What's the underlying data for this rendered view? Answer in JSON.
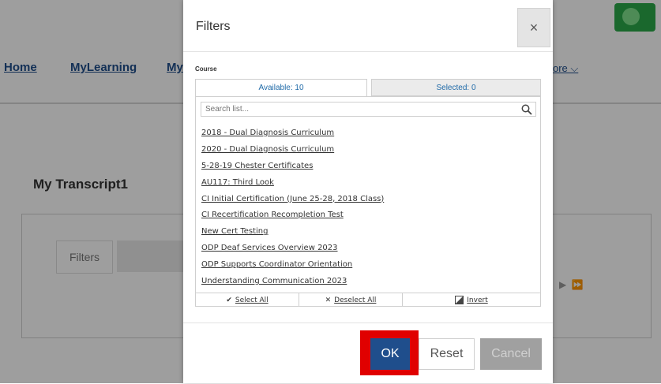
{
  "background": {
    "nav": [
      "Home",
      "MyLearning",
      "My"
    ],
    "nav_more": "ore ⌵",
    "page_title": "My Transcript1",
    "card_button": "Filters"
  },
  "modal": {
    "title": "Filters",
    "close_symbol": "×",
    "section_label": "Course",
    "tab_available": "Available: 10",
    "tab_selected": "Selected: 0",
    "search_placeholder": "Search list...",
    "items": [
      "2018 - Dual Diagnosis Curriculum",
      "2020 - Dual Diagnosis Curriculum",
      "5-28-19 Chester Certificates",
      "AU117: Third Look",
      "CI Initial Certification (June 25-28, 2018 Class)",
      "CI Recertification Recompletion Test",
      "New Cert Testing",
      "ODP Deaf Services Overview 2023",
      "ODP Supports Coordinator Orientation",
      "Understanding Communication 2023"
    ],
    "footer": {
      "select_all": "Select All",
      "deselect_all": "Deselect All",
      "invert": "Invert"
    },
    "buttons": {
      "ok": "OK",
      "reset": "Reset",
      "cancel": "Cancel"
    }
  }
}
